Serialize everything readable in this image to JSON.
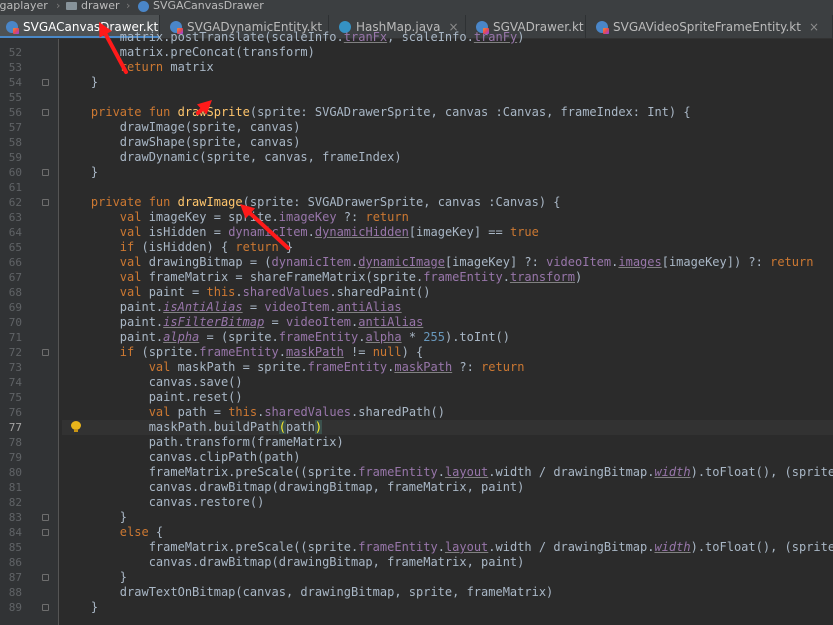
{
  "breadcrumb": [
    {
      "label": "vgaplayer",
      "icon": "folder-icon"
    },
    {
      "label": "drawer",
      "icon": "folder-icon"
    },
    {
      "label": "SVGACanvasDrawer",
      "icon": "kotlin-file-icon"
    }
  ],
  "tabs": [
    {
      "label": "SVGACanvasDrawer.kt",
      "icon": "kotlin-file-icon",
      "active": true
    },
    {
      "label": "SVGADynamicEntity.kt",
      "icon": "kotlin-file-icon",
      "active": false
    },
    {
      "label": "HashMap.java",
      "icon": "java-class-icon",
      "active": false
    },
    {
      "label": "SGVADrawer.kt",
      "icon": "kotlin-file-icon",
      "active": false
    },
    {
      "label": "SVGAVideoSpriteFrameEntity.kt",
      "icon": "kotlin-file-icon",
      "active": false
    }
  ],
  "tab_close_glyph": "×",
  "current_line": "77",
  "lines": [
    {
      "n": "52",
      "t": [
        [
          "",
          "        matrix.preConcat(transform)"
        ]
      ]
    },
    {
      "n": "53",
      "t": [
        [
          "",
          "        "
        ],
        [
          "k",
          "return "
        ],
        [
          "",
          "matrix"
        ]
      ]
    },
    {
      "n": "54",
      "t": [
        [
          "",
          "    }"
        ]
      ]
    },
    {
      "n": "55",
      "t": []
    },
    {
      "n": "56",
      "t": [
        [
          "",
          "    "
        ],
        [
          "k",
          "private fun "
        ],
        [
          "f",
          "drawSprite"
        ],
        [
          "",
          "(sprite: SVGADrawerSprite, canvas :Canvas, frameIndex: Int) {"
        ]
      ]
    },
    {
      "n": "57",
      "t": [
        [
          "",
          "        drawImage(sprite, canvas)"
        ]
      ]
    },
    {
      "n": "58",
      "t": [
        [
          "",
          "        drawShape(sprite, canvas)"
        ]
      ]
    },
    {
      "n": "59",
      "t": [
        [
          "",
          "        drawDynamic(sprite, canvas, frameIndex)"
        ]
      ]
    },
    {
      "n": "60",
      "t": [
        [
          "",
          "    }"
        ]
      ]
    },
    {
      "n": "61",
      "t": []
    },
    {
      "n": "62",
      "t": [
        [
          "",
          "    "
        ],
        [
          "k",
          "private fun "
        ],
        [
          "f",
          "drawImage"
        ],
        [
          "",
          "(sprite: SVGADrawerSprite, canvas :Canvas) {"
        ]
      ]
    },
    {
      "n": "63",
      "t": [
        [
          "",
          "        "
        ],
        [
          "k",
          "val "
        ],
        [
          "",
          "imageKey = sprite."
        ],
        [
          "p",
          "imageKey "
        ],
        [
          "",
          "?: "
        ],
        [
          "k",
          "return"
        ]
      ]
    },
    {
      "n": "64",
      "t": [
        [
          "",
          "        "
        ],
        [
          "k",
          "val "
        ],
        [
          "",
          "isHidden = "
        ],
        [
          "p",
          "dynamicItem"
        ],
        [
          "",
          "."
        ],
        [
          "pu",
          "dynamicHidden"
        ],
        [
          "",
          "[imageKey] == "
        ],
        [
          "k",
          "true"
        ]
      ]
    },
    {
      "n": "65",
      "t": [
        [
          "",
          "        "
        ],
        [
          "k",
          "if "
        ],
        [
          "",
          "(isHidden) { "
        ],
        [
          "k",
          "return "
        ],
        [
          "",
          "}"
        ]
      ]
    },
    {
      "n": "66",
      "t": [
        [
          "",
          "        "
        ],
        [
          "k",
          "val "
        ],
        [
          "",
          "drawingBitmap = ("
        ],
        [
          "p",
          "dynamicItem"
        ],
        [
          "",
          "."
        ],
        [
          "pu",
          "dynamicImage"
        ],
        [
          "",
          "[imageKey] ?: "
        ],
        [
          "p",
          "videoItem"
        ],
        [
          "",
          "."
        ],
        [
          "pu",
          "images"
        ],
        [
          "",
          "[imageKey]) ?: "
        ],
        [
          "k",
          "return"
        ]
      ]
    },
    {
      "n": "67",
      "t": [
        [
          "",
          "        "
        ],
        [
          "k",
          "val "
        ],
        [
          "",
          "frameMatrix = shareFrameMatrix(sprite."
        ],
        [
          "p",
          "frameEntity"
        ],
        [
          "",
          "."
        ],
        [
          "pu",
          "transform"
        ],
        [
          "",
          ")"
        ]
      ]
    },
    {
      "n": "68",
      "t": [
        [
          "",
          "        "
        ],
        [
          "k",
          "val "
        ],
        [
          "",
          "paint = "
        ],
        [
          "k",
          "this"
        ],
        [
          "",
          "."
        ],
        [
          "p",
          "sharedValues"
        ],
        [
          "",
          ".sharedPaint()"
        ]
      ]
    },
    {
      "n": "69",
      "t": [
        [
          "",
          "        paint."
        ],
        [
          "piu",
          "isAntiAlias"
        ],
        [
          "",
          " = "
        ],
        [
          "p",
          "videoItem"
        ],
        [
          "",
          "."
        ],
        [
          "pu",
          "antiAlias"
        ]
      ]
    },
    {
      "n": "70",
      "t": [
        [
          "",
          "        paint."
        ],
        [
          "piu",
          "isFilterBitmap"
        ],
        [
          "",
          " = "
        ],
        [
          "p",
          "videoItem"
        ],
        [
          "",
          "."
        ],
        [
          "pu",
          "antiAlias"
        ]
      ]
    },
    {
      "n": "71",
      "t": [
        [
          "",
          "        paint."
        ],
        [
          "piu",
          "alpha"
        ],
        [
          "",
          " = (sprite."
        ],
        [
          "p",
          "frameEntity"
        ],
        [
          "",
          "."
        ],
        [
          "pu",
          "alpha"
        ],
        [
          "",
          " * "
        ],
        [
          "n",
          "255"
        ],
        [
          "",
          ").toInt()"
        ]
      ]
    },
    {
      "n": "72",
      "t": [
        [
          "",
          "        "
        ],
        [
          "k",
          "if "
        ],
        [
          "",
          "(sprite."
        ],
        [
          "p",
          "frameEntity"
        ],
        [
          "",
          "."
        ],
        [
          "pu",
          "maskPath"
        ],
        [
          "",
          " != "
        ],
        [
          "k",
          "null"
        ],
        [
          "",
          ") {"
        ]
      ]
    },
    {
      "n": "73",
      "t": [
        [
          "",
          "            "
        ],
        [
          "k",
          "val "
        ],
        [
          "",
          "maskPath = sprite."
        ],
        [
          "p",
          "frameEntity"
        ],
        [
          "",
          "."
        ],
        [
          "pu",
          "maskPath"
        ],
        [
          "",
          " ?: "
        ],
        [
          "k",
          "return"
        ]
      ]
    },
    {
      "n": "74",
      "t": [
        [
          "",
          "            canvas.save()"
        ]
      ]
    },
    {
      "n": "75",
      "t": [
        [
          "",
          "            paint.reset()"
        ]
      ]
    },
    {
      "n": "76",
      "t": [
        [
          "",
          "            "
        ],
        [
          "k",
          "val "
        ],
        [
          "",
          "path = "
        ],
        [
          "k",
          "this"
        ],
        [
          "",
          "."
        ],
        [
          "p",
          "sharedValues"
        ],
        [
          "",
          ".sharedPath()"
        ]
      ]
    },
    {
      "n": "77",
      "t": [
        [
          "",
          "            maskPath.buildPath"
        ],
        [
          "bm",
          "("
        ],
        [
          "",
          "path"
        ],
        [
          "bm",
          ")"
        ]
      ]
    },
    {
      "n": "78",
      "t": [
        [
          "",
          "            path.transform(frameMatrix)"
        ]
      ]
    },
    {
      "n": "79",
      "t": [
        [
          "",
          "            canvas.clipPath(path)"
        ]
      ]
    },
    {
      "n": "80",
      "t": [
        [
          "",
          "            frameMatrix.preScale((sprite."
        ],
        [
          "p",
          "frameEntity"
        ],
        [
          "",
          "."
        ],
        [
          "pu",
          "layout"
        ],
        [
          "",
          ".width / drawingBitmap."
        ],
        [
          "piu",
          "width"
        ],
        [
          "",
          ").toFloat(), (sprite.fr"
        ]
      ]
    },
    {
      "n": "81",
      "t": [
        [
          "",
          "            canvas.drawBitmap(drawingBitmap, frameMatrix, paint)"
        ]
      ]
    },
    {
      "n": "82",
      "t": [
        [
          "",
          "            canvas.restore()"
        ]
      ]
    },
    {
      "n": "83",
      "t": [
        [
          "",
          "        }"
        ]
      ]
    },
    {
      "n": "84",
      "t": [
        [
          "",
          "        "
        ],
        [
          "k",
          "else "
        ],
        [
          "",
          "{"
        ]
      ]
    },
    {
      "n": "85",
      "t": [
        [
          "",
          "            frameMatrix.preScale((sprite."
        ],
        [
          "p",
          "frameEntity"
        ],
        [
          "",
          "."
        ],
        [
          "pu",
          "layout"
        ],
        [
          "",
          ".width / drawingBitmap."
        ],
        [
          "piu",
          "width"
        ],
        [
          "",
          ").toFloat(), (sprite.fr"
        ]
      ]
    },
    {
      "n": "86",
      "t": [
        [
          "",
          "            canvas.drawBitmap(drawingBitmap, frameMatrix, paint)"
        ]
      ]
    },
    {
      "n": "87",
      "t": [
        [
          "",
          "        }"
        ]
      ]
    },
    {
      "n": "88",
      "t": [
        [
          "",
          "        drawTextOnBitmap(canvas, drawingBitmap, sprite, frameMatrix)"
        ]
      ]
    },
    {
      "n": "89",
      "t": [
        [
          "",
          "    }"
        ]
      ]
    }
  ],
  "partial_top_line": [
    [
      "",
      "        matrix.postTranslate(scaleInfo."
    ],
    [
      "pu",
      "tranFx"
    ],
    [
      "",
      ", scaleInfo."
    ],
    [
      "pu",
      "tranFy"
    ],
    [
      "",
      ")"
    ]
  ],
  "annotation_color": "#ff1a1a"
}
